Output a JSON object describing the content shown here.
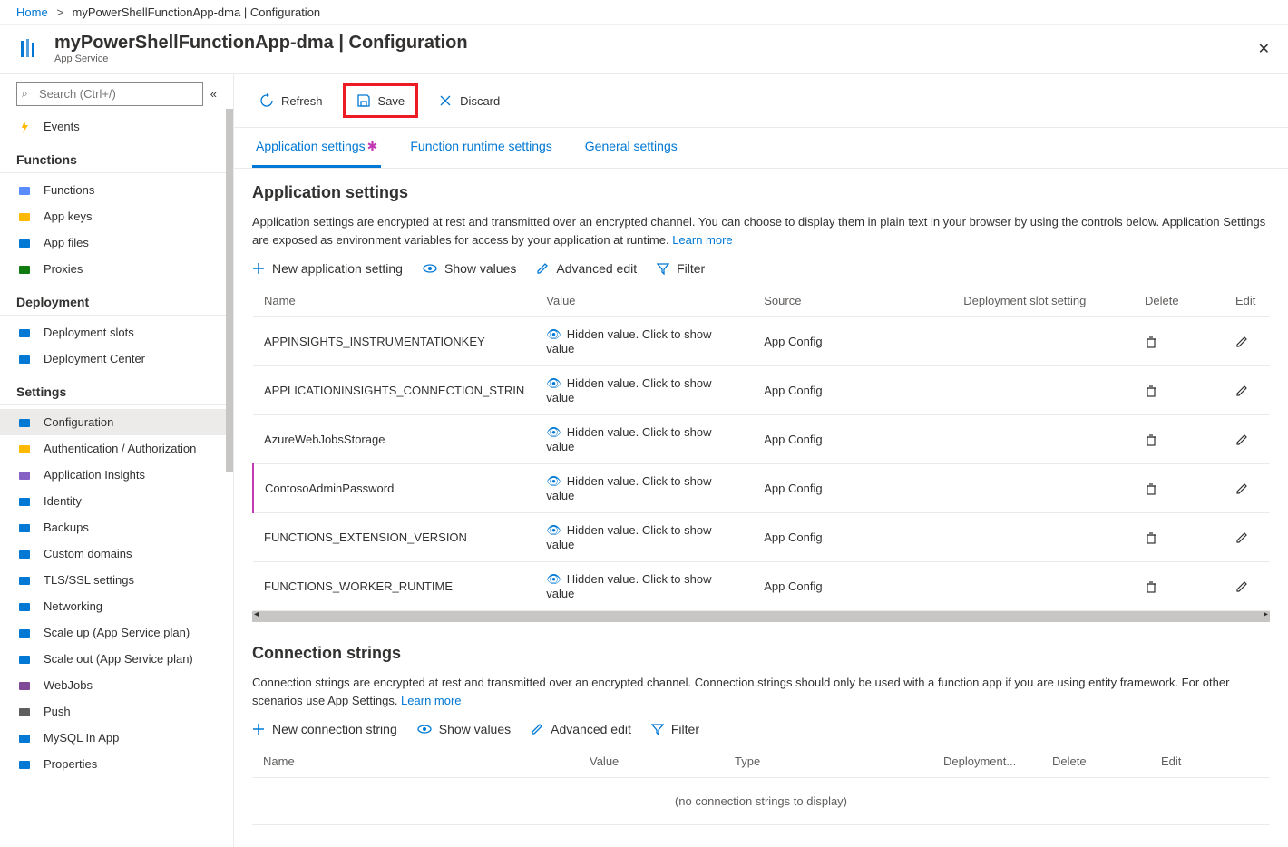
{
  "breadcrumb": {
    "home": "Home",
    "current": "myPowerShellFunctionApp-dma | Configuration"
  },
  "header": {
    "title": "myPowerShellFunctionApp-dma | Configuration",
    "subtitle": "App Service"
  },
  "search": {
    "placeholder": "Search (Ctrl+/)"
  },
  "sidebar": {
    "top": {
      "events": "Events"
    },
    "groups": [
      {
        "title": "Functions",
        "items": [
          {
            "label": "Functions",
            "color": "#598cff"
          },
          {
            "label": "App keys",
            "color": "#ffb900"
          },
          {
            "label": "App files",
            "color": "#0078d4"
          },
          {
            "label": "Proxies",
            "color": "#107c10"
          }
        ]
      },
      {
        "title": "Deployment",
        "items": [
          {
            "label": "Deployment slots",
            "color": "#0078d4"
          },
          {
            "label": "Deployment Center",
            "color": "#0078d4"
          }
        ]
      },
      {
        "title": "Settings",
        "items": [
          {
            "label": "Configuration",
            "active": true,
            "color": "#0078d4"
          },
          {
            "label": "Authentication / Authorization",
            "color": "#ffb900"
          },
          {
            "label": "Application Insights",
            "color": "#8661c5"
          },
          {
            "label": "Identity",
            "color": "#0078d4"
          },
          {
            "label": "Backups",
            "color": "#0078d4"
          },
          {
            "label": "Custom domains",
            "color": "#0078d4"
          },
          {
            "label": "TLS/SSL settings",
            "color": "#0078d4"
          },
          {
            "label": "Networking",
            "color": "#0078d4"
          },
          {
            "label": "Scale up (App Service plan)",
            "color": "#0078d4"
          },
          {
            "label": "Scale out (App Service plan)",
            "color": "#0078d4"
          },
          {
            "label": "WebJobs",
            "color": "#804998"
          },
          {
            "label": "Push",
            "color": "#605e5c"
          },
          {
            "label": "MySQL In App",
            "color": "#0078d4"
          },
          {
            "label": "Properties",
            "color": "#0078d4"
          }
        ]
      }
    ]
  },
  "toolbar": {
    "refresh": "Refresh",
    "save": "Save",
    "discard": "Discard"
  },
  "tabs": {
    "app": "Application settings",
    "runtime": "Function runtime settings",
    "general": "General settings"
  },
  "appsettings": {
    "title": "Application settings",
    "desc": "Application settings are encrypted at rest and transmitted over an encrypted channel. You can choose to display them in plain text in your browser by using the controls below. Application Settings are exposed as environment variables for access by your application at runtime. ",
    "learn": "Learn more",
    "actions": {
      "new": "New application setting",
      "show": "Show values",
      "adv": "Advanced edit",
      "filter": "Filter"
    },
    "cols": {
      "name": "Name",
      "value": "Value",
      "source": "Source",
      "slot": "Deployment slot setting",
      "delete": "Delete",
      "edit": "Edit"
    },
    "hidden": "Hidden value. Click to show value",
    "rows": [
      {
        "name": "APPINSIGHTS_INSTRUMENTATIONKEY",
        "source": "App Config"
      },
      {
        "name": "APPLICATIONINSIGHTS_CONNECTION_STRIN",
        "source": "App Config"
      },
      {
        "name": "AzureWebJobsStorage",
        "source": "App Config"
      },
      {
        "name": "ContosoAdminPassword",
        "source": "App Config",
        "dirty": true
      },
      {
        "name": "FUNCTIONS_EXTENSION_VERSION",
        "source": "App Config"
      },
      {
        "name": "FUNCTIONS_WORKER_RUNTIME",
        "source": "App Config"
      }
    ]
  },
  "connstrings": {
    "title": "Connection strings",
    "desc": "Connection strings are encrypted at rest and transmitted over an encrypted channel. Connection strings should only be used with a function app if you are using entity framework. For other scenarios use App Settings. ",
    "learn": "Learn more",
    "actions": {
      "new": "New connection string",
      "show": "Show values",
      "adv": "Advanced edit",
      "filter": "Filter"
    },
    "cols": {
      "name": "Name",
      "value": "Value",
      "type": "Type",
      "slot": "Deployment...",
      "delete": "Delete",
      "edit": "Edit"
    },
    "empty": "(no connection strings to display)"
  }
}
